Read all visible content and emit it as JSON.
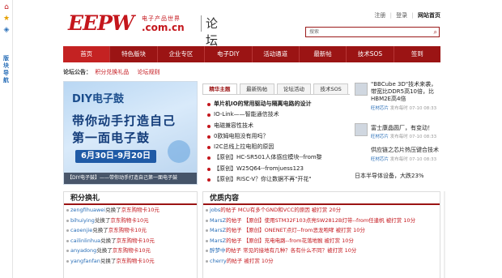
{
  "left_strip": {
    "icon1": "home-icon",
    "icon2": "star-icon",
    "icon3": "gamepad-icon",
    "vertical_text": "版块导航"
  },
  "header": {
    "logo_text": "EEPW",
    "logo_cn": "电子产品世界",
    "logo_domain": ".com.cn",
    "forum_label": "论坛",
    "links": {
      "register": "注册",
      "login": "登录",
      "site_home": "网站首页"
    },
    "search_placeholder": "搜索"
  },
  "nav": {
    "items": [
      {
        "label": "首页",
        "active": true
      },
      {
        "label": "特色版块",
        "active": false
      },
      {
        "label": "企业专区",
        "active": false
      },
      {
        "label": "电子DIY",
        "active": false
      },
      {
        "label": "活动通道",
        "active": false
      },
      {
        "label": "最新帖",
        "active": false
      },
      {
        "label": "技术SOS",
        "active": false
      },
      {
        "label": "签到",
        "active": false
      }
    ]
  },
  "announce": {
    "label": "论坛公告：",
    "link1": "积分兑换礼品",
    "link2": "论坛规则"
  },
  "banner": {
    "title": "DIY电子鼓",
    "line1": "带你动手打造自己",
    "line2": "第一面电子鼓",
    "date": "6月30日-9月20日",
    "caption": "【DIY电子鼓】——带你动手打造自己第一面电子鼓"
  },
  "tabs": {
    "items": [
      {
        "label": "精华主题",
        "active": true
      },
      {
        "label": "最新热帖",
        "active": false
      },
      {
        "label": "论坛活动",
        "active": false
      },
      {
        "label": "技术SOS",
        "active": false
      }
    ]
  },
  "posts": [
    "单片机IO的常用驱动与隔离电路的设计",
    "IO-Link——智能通信技术",
    "电磁兼容性技术",
    "0欧姆电阻没有用吗？",
    "I2C总线上拉电阻的原因",
    "【原创】HC-SR501人体感应模块--from黎",
    "【原创】W25Q64--fromjuess123",
    "【原创】RISC-V？你让数据不再\"开花\""
  ],
  "news": {
    "item1_title": "\"BBCube 3D\"技术来袭，带宽比DDR5高10倍，比HBM2E高4倍",
    "item1_src": "旺材芯片",
    "item1_time": "发布每时 07-10 08:33",
    "item2_title": "富士康晶圆厂，有变动！",
    "item2_src": "旺材芯片",
    "item2_time": "发布每时 07-10 08:33",
    "item3_title": "供应链之芯片热压键合技术",
    "item3_src": "旺材芯片",
    "item3_time": "发布每时 07-10 08:33",
    "item4_title": "日本半导体设备，大跌23%"
  },
  "points": {
    "header": "积分换礼",
    "rows": [
      {
        "user": "zengfihuawei",
        "action": "兑换了",
        "item": "京东购物卡10元"
      },
      {
        "user": "bihuiying",
        "action": "兑换了",
        "item": "京东购物卡10元"
      },
      {
        "user": "caoenjie",
        "action": "兑换了",
        "item": "京东购物卡10元"
      },
      {
        "user": "cailinlinhua",
        "action": "兑换了",
        "item": "京东购物卡10元"
      },
      {
        "user": "anyadong",
        "action": "兑换了",
        "item": "京东购物卡10元"
      },
      {
        "user": "yangfanfan",
        "action": "兑换了",
        "item": "京东购物卡10元"
      }
    ]
  },
  "content": {
    "header": "优质内容",
    "rows": [
      {
        "user": "jobs",
        "text": "的帖子 MCU有多个GND和VCC的原因 被打赏 20分"
      },
      {
        "user": "MarsZ",
        "text": "的帖子 【原创】使用STM32F103点亮SW2812B灯带--from任逢帆 被打赏 10分"
      },
      {
        "user": "MarsZ",
        "text": "的帖子 【原创】ONENET点灯--from恶龙咆哮 被打赏 10分"
      },
      {
        "user": "MarsZ",
        "text": "的帖子 【原创】充电电路--from花落地猴 被打赏 10分"
      },
      {
        "user": "醉梦中",
        "text": "的帖子 常见的接地有几种？各有什么不同？被打赏 10分"
      },
      {
        "user": "cherry",
        "text": "的帖子 被打赏 10分"
      }
    ]
  }
}
